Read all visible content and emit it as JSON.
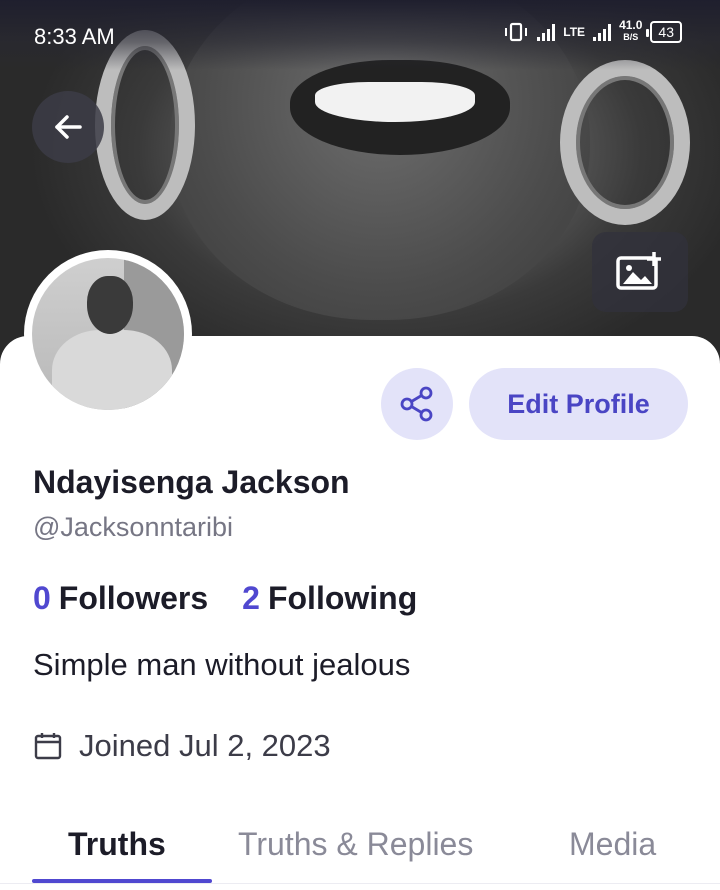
{
  "status_bar": {
    "time": "8:33 AM",
    "network_type": "LTE",
    "net_speed_value": "41.0",
    "net_speed_unit": "B/S",
    "battery": "43"
  },
  "header": {
    "back_icon": "arrow-left-icon",
    "cover_edit_icon": "image-plus-icon"
  },
  "profile": {
    "name": "Ndayisenga Jackson",
    "handle": "@Jacksonntaribi",
    "followers_count": "0",
    "followers_label": "Followers",
    "following_count": "2",
    "following_label": "Following",
    "bio": "Simple man without jealous",
    "joined": "Joined Jul 2, 2023"
  },
  "actions": {
    "share_icon": "share-icon",
    "edit_profile_label": "Edit Profile"
  },
  "tabs": [
    {
      "label": "Truths",
      "active": true
    },
    {
      "label": "Truths & Replies",
      "active": false
    },
    {
      "label": "Media",
      "active": false
    }
  ],
  "colors": {
    "accent": "#5048d0",
    "button_bg": "#e3e3f9",
    "text_primary": "#1c1c28",
    "text_secondary": "#767684"
  }
}
